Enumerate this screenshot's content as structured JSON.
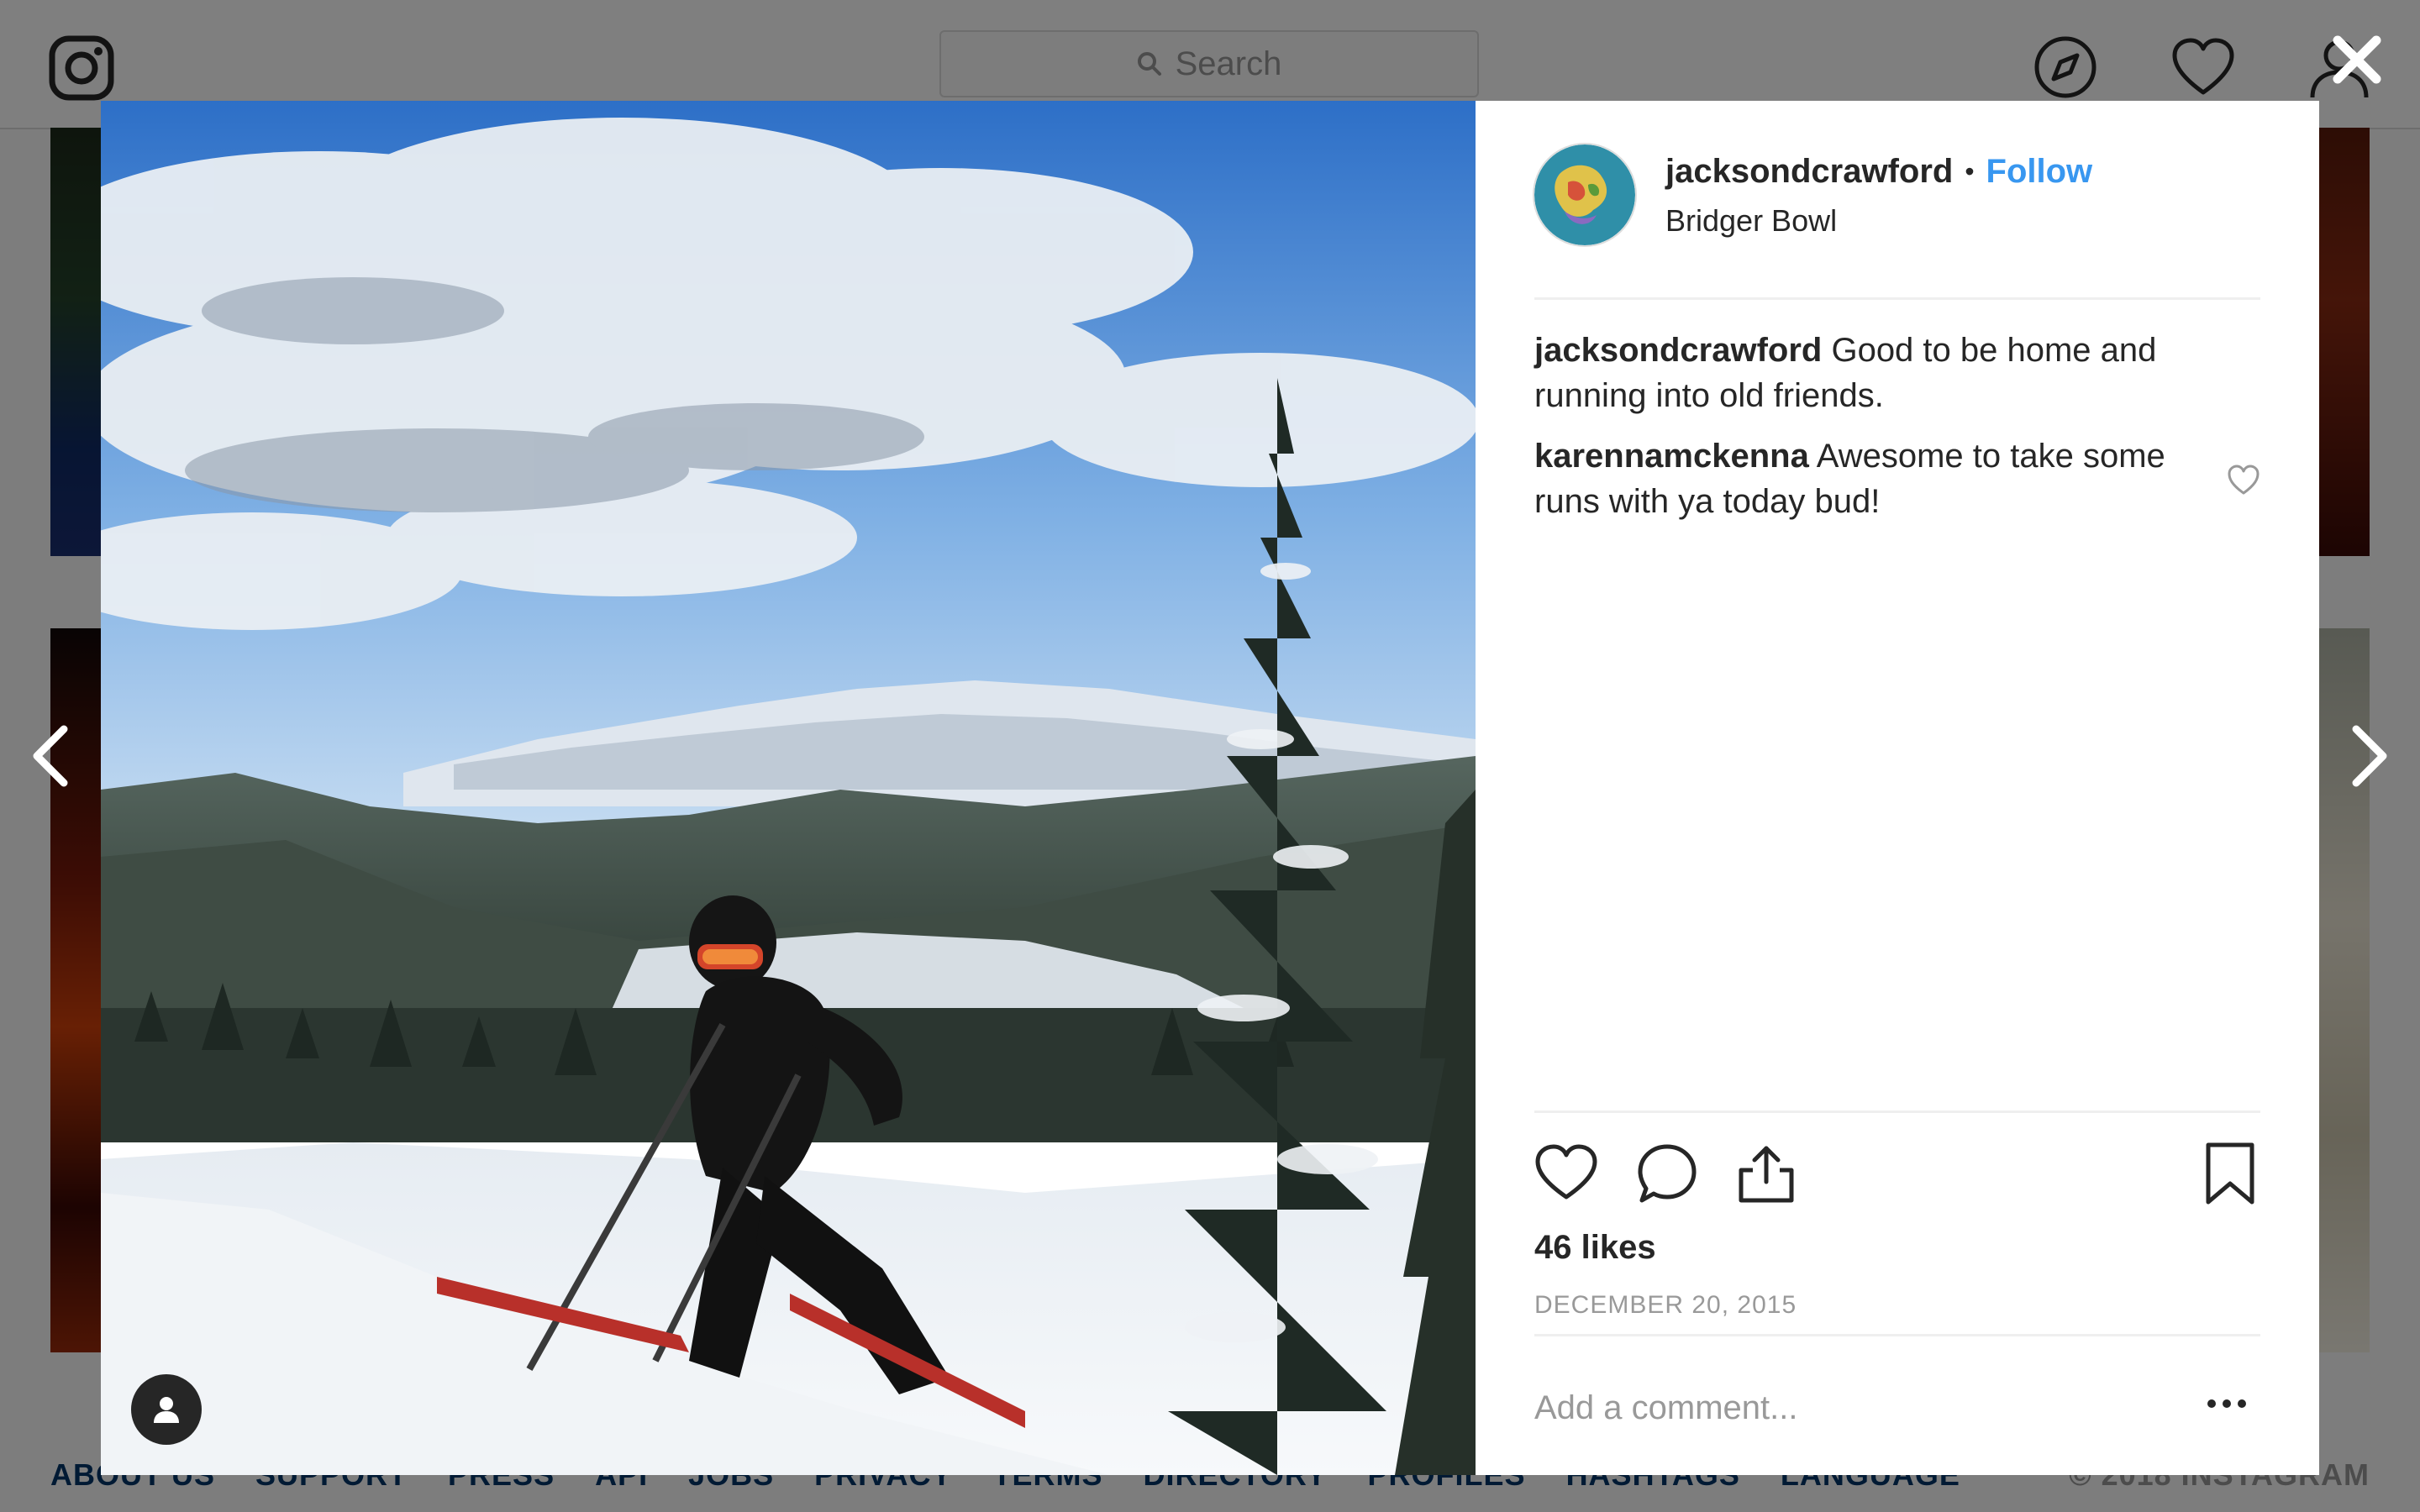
{
  "nav": {
    "search_placeholder": "Search",
    "icons": [
      "instagram-logo-icon",
      "search-icon",
      "compass-icon",
      "heart-icon",
      "user-icon"
    ]
  },
  "footer": {
    "links": [
      "ABOUT US",
      "SUPPORT",
      "PRESS",
      "API",
      "JOBS",
      "PRIVACY",
      "TERMS",
      "DIRECTORY",
      "PROFILES",
      "HASHTAGS",
      "LANGUAGE"
    ],
    "copyright": "© 2018 INSTAGRAM"
  },
  "post": {
    "username": "jacksondcrawford",
    "separator": "•",
    "follow_label": "Follow",
    "location": "Bridger Bowl",
    "comments": [
      {
        "user": "jacksondcrawford",
        "text": "Good to be home and running into old friends."
      },
      {
        "user": "karennamckenna",
        "text": "Awesome to take some runs with ya today bud!"
      }
    ],
    "likes": "46 likes",
    "date": "DECEMBER 20, 2015",
    "comment_placeholder": "Add a comment..."
  },
  "colors": {
    "accent": "#3897f0",
    "text": "#262626",
    "muted": "#999999",
    "overlay": "rgba(0,0,0,0.5)"
  }
}
